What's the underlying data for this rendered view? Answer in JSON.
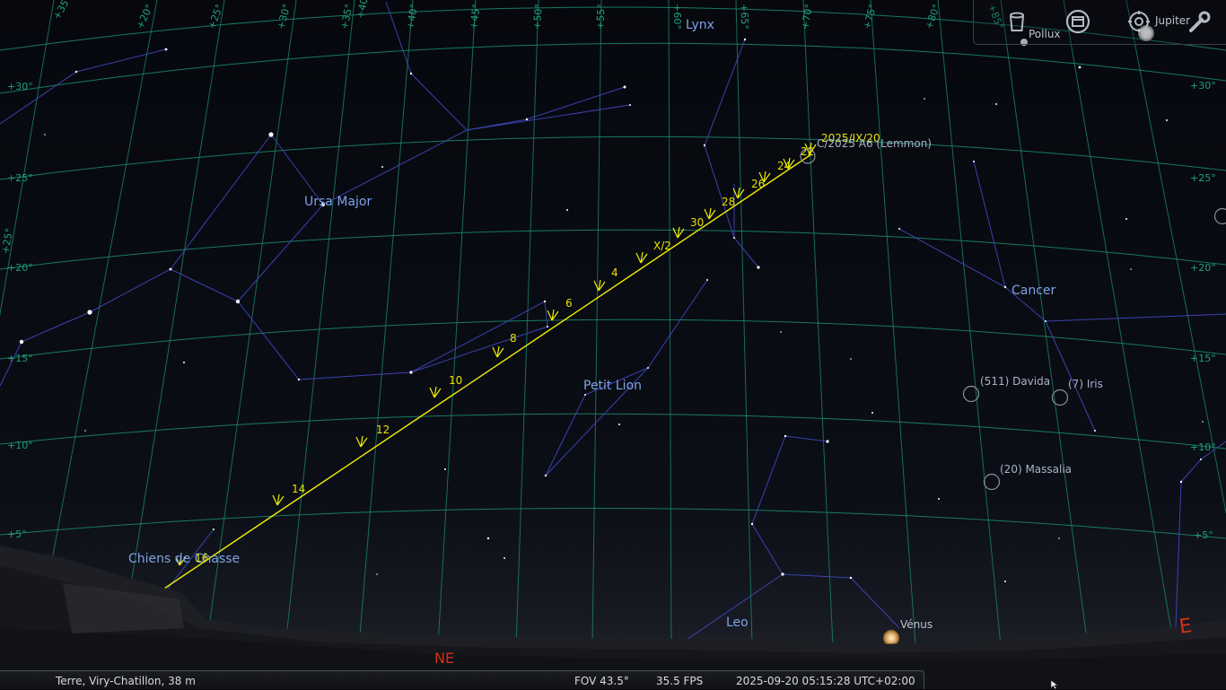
{
  "app": "Stellarium",
  "colors": {
    "sky": "#06080e",
    "grid": "#1c8c70",
    "constellation_lines": "#3f46b4",
    "constellation_labels": "#7fa2e6",
    "comet_path": "#f0ee00",
    "cardinal": "#d23018",
    "object_labels": "#a8b4c8"
  },
  "constellations": [
    {
      "id": "lynx",
      "label": "Lynx"
    },
    {
      "id": "ursa-major",
      "label": "Ursa Major"
    },
    {
      "id": "cancer",
      "label": "Cancer"
    },
    {
      "id": "leo-minor",
      "label": "Petit Lion"
    },
    {
      "id": "canes-venatici",
      "label": "Chiens de Chasse"
    },
    {
      "id": "leo",
      "label": "Leo"
    }
  ],
  "comet": {
    "name": "C/2025 A6 (Lemmon)",
    "start_date": "2025/IX/20",
    "ticks": [
      "22",
      "24",
      "26",
      "28",
      "30",
      "X/2",
      "4",
      "6",
      "8",
      "10",
      "12",
      "14",
      "16"
    ]
  },
  "objects": [
    {
      "id": "davida",
      "label": "(511) Davida"
    },
    {
      "id": "iris",
      "label": "(7) Iris"
    },
    {
      "id": "massalia",
      "label": "(20) Massalia"
    }
  ],
  "planets": [
    {
      "id": "venus",
      "label": "Vénus"
    },
    {
      "id": "jupiter",
      "label": "Jupiter"
    },
    {
      "id": "pollux",
      "label": "Pollux"
    }
  ],
  "cardinals": {
    "ne": "NE",
    "e": "E"
  },
  "grid_labels": {
    "top": [
      "+35°",
      "+20°",
      "+25°",
      "+30°",
      "+35°",
      "+40°",
      "+40°",
      "+45°",
      "+50°",
      "+55°",
      "+60°",
      "+65°",
      "+70°",
      "+75°",
      "+80°",
      "+85°"
    ],
    "left": [
      "+30°",
      "+25°",
      "+20°",
      "+15°",
      "+10°",
      "+5°",
      "+25°"
    ],
    "right": [
      "+30°",
      "+25°",
      "+20°",
      "+15°",
      "+10°",
      "+5°"
    ]
  },
  "toolbar": {
    "buttons": [
      {
        "id": "trash",
        "icon": "trash-icon"
      },
      {
        "id": "window",
        "icon": "window-icon"
      },
      {
        "id": "settings",
        "icon": "settings-icon"
      },
      {
        "id": "wrench",
        "icon": "wrench-icon"
      }
    ]
  },
  "status": {
    "location": "Terre, Viry-Chatillon, 38 m",
    "fov": "FOV 43.5°",
    "fps": "35.5 FPS",
    "datetime": "2025-09-20 05:15:28 UTC+02:00"
  }
}
